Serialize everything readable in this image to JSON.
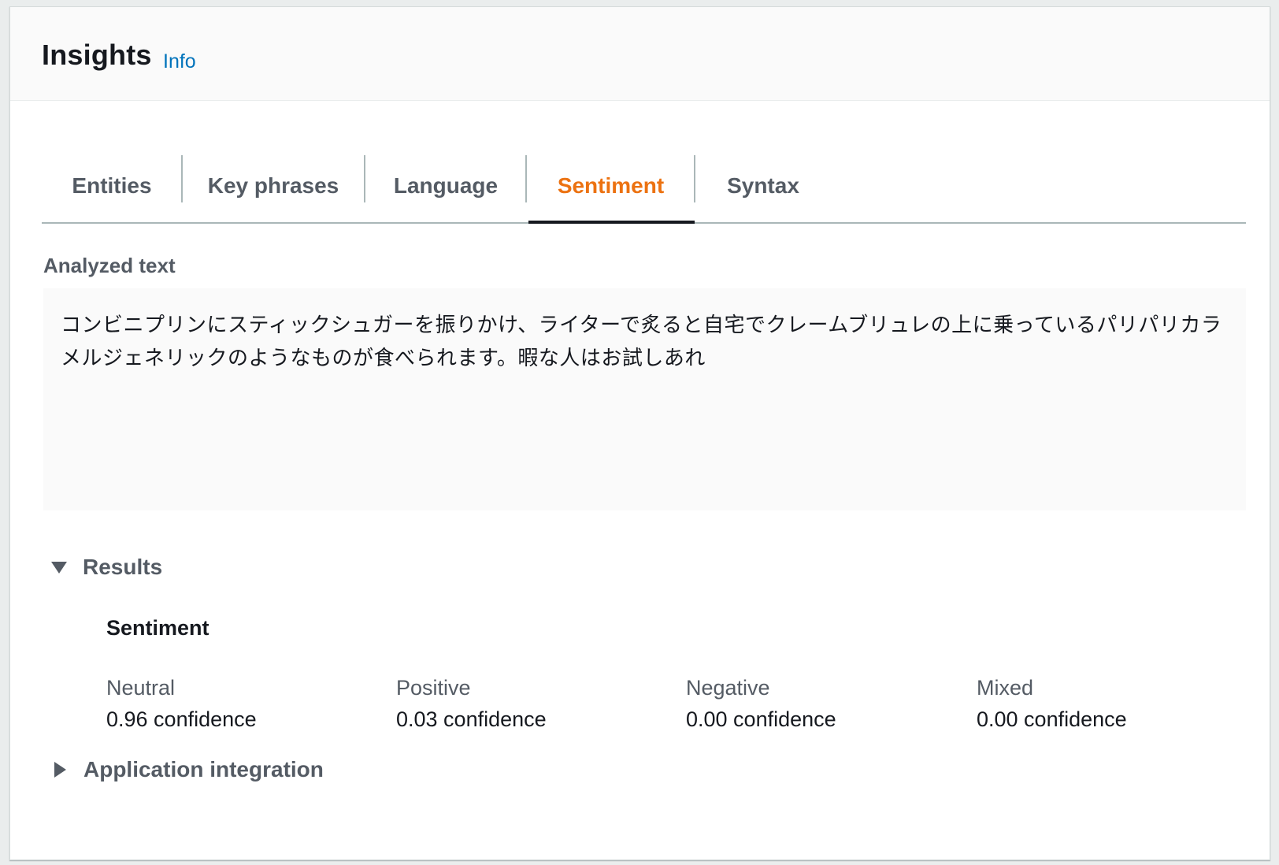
{
  "header": {
    "title": "Insights",
    "info_link": "Info"
  },
  "tabs": [
    {
      "label": "Entities",
      "active": false
    },
    {
      "label": "Key phrases",
      "active": false
    },
    {
      "label": "Language",
      "active": false
    },
    {
      "label": "Sentiment",
      "active": true
    },
    {
      "label": "Syntax",
      "active": false
    }
  ],
  "analyzed": {
    "label": "Analyzed text",
    "text": "コンビニプリンにスティックシュガーを振りかけ、ライターで炙ると自宅でクレームブリュレの上に乗っているパリパリカラメルジェネリックのようなものが食べられます。暇な人はお試しあれ"
  },
  "results": {
    "label": "Results",
    "expanded": true,
    "heading": "Sentiment",
    "metrics": [
      {
        "name": "Neutral",
        "value": "0.96 confidence"
      },
      {
        "name": "Positive",
        "value": "0.03 confidence"
      },
      {
        "name": "Negative",
        "value": "0.00 confidence"
      },
      {
        "name": "Mixed",
        "value": "0.00 confidence"
      }
    ]
  },
  "application_integration": {
    "label": "Application integration",
    "expanded": false
  },
  "colors": {
    "active_tab": "#ec7211",
    "link": "#0073bb",
    "text_dark": "#16191f",
    "text_muted": "#545b64"
  }
}
